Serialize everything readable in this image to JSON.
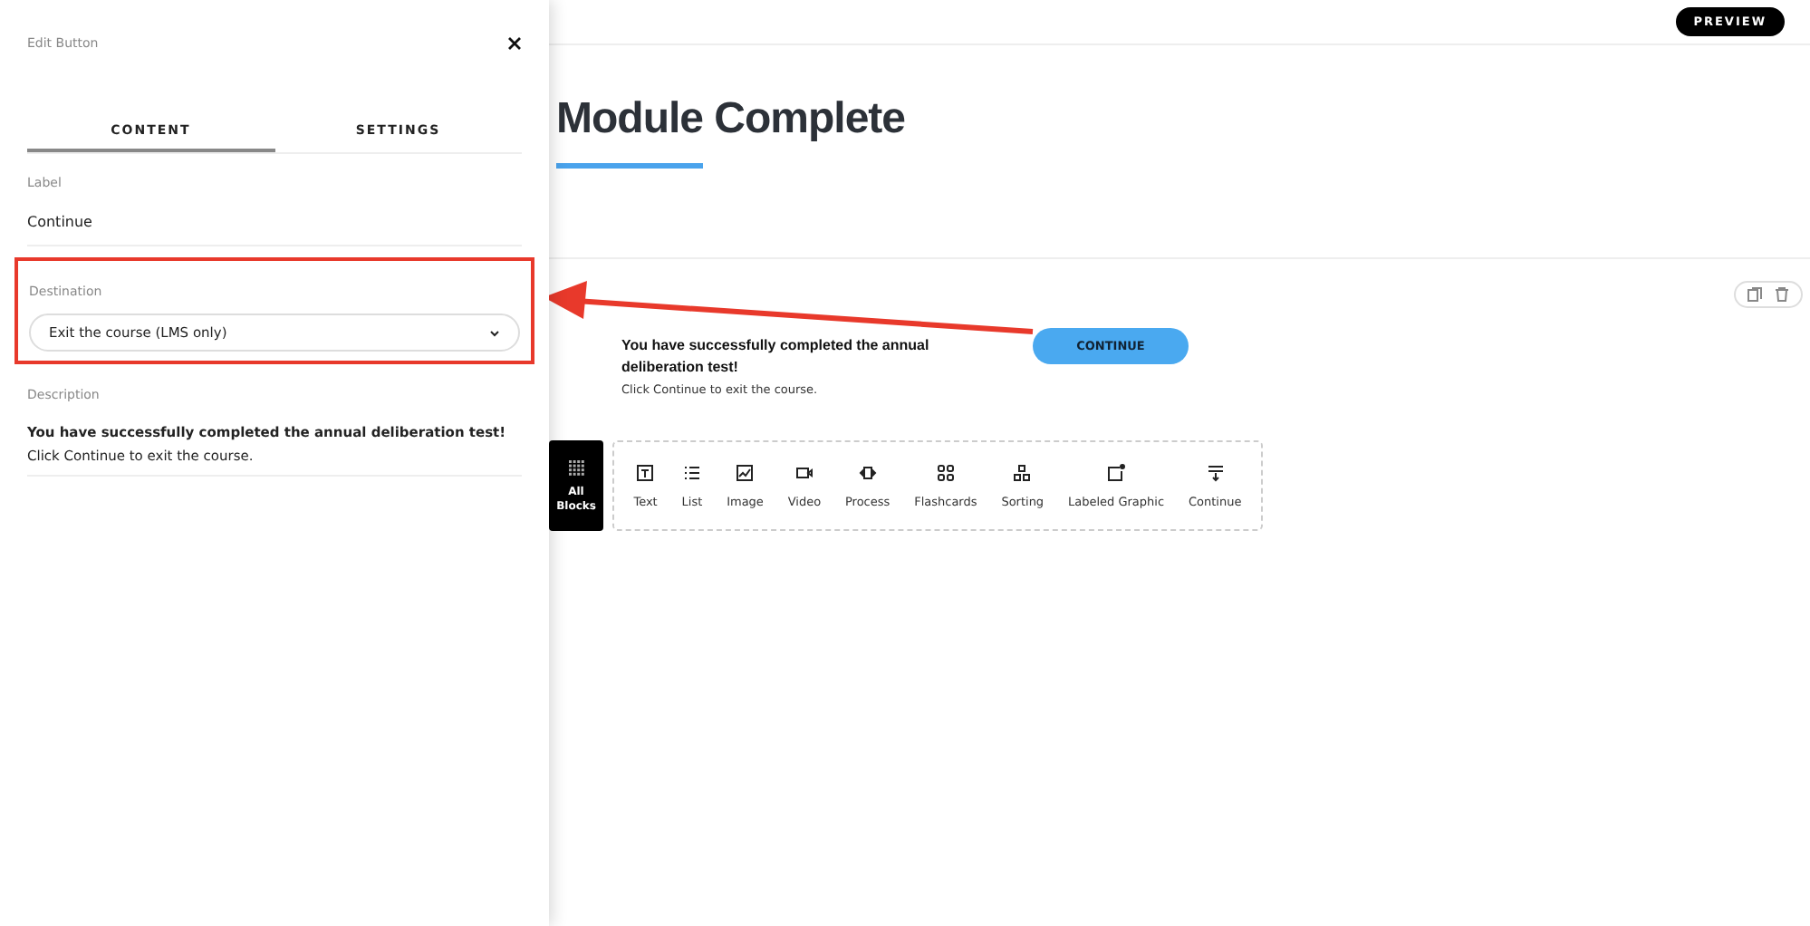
{
  "panel": {
    "title": "Edit Button",
    "tabs": [
      {
        "label": "CONTENT",
        "selected": true
      },
      {
        "label": "SETTINGS",
        "selected": false
      }
    ],
    "label_field": {
      "label": "Label",
      "value": "Continue"
    },
    "destination": {
      "label": "Destination",
      "value": "Exit the course (LMS only)",
      "highlighted": true
    },
    "description": {
      "label": "Description",
      "lines": [
        "**You have successfully completed the annual deliberation test!**",
        "Click Continue to exit the course."
      ]
    }
  },
  "header": {
    "preview": "PREVIEW"
  },
  "lesson": {
    "title": "Module Complete",
    "block_text": "You have successfully completed the annual deliberation test!",
    "block_subtext": "Click Continue to exit the course.",
    "button": "CONTINUE"
  },
  "block_menu": {
    "all_blocks": [
      "All",
      "Blocks"
    ],
    "items": [
      {
        "label": "Text",
        "kind": "text"
      },
      {
        "label": "List",
        "kind": "list"
      },
      {
        "label": "Image",
        "kind": "image"
      },
      {
        "label": "Video",
        "kind": "video"
      },
      {
        "label": "Process",
        "kind": "process"
      },
      {
        "label": "Flashcards",
        "kind": "flashcards"
      },
      {
        "label": "Sorting",
        "kind": "sorting"
      },
      {
        "label": "Labeled Graphic",
        "kind": "graphic"
      },
      {
        "label": "Continue",
        "kind": "continue"
      }
    ]
  }
}
